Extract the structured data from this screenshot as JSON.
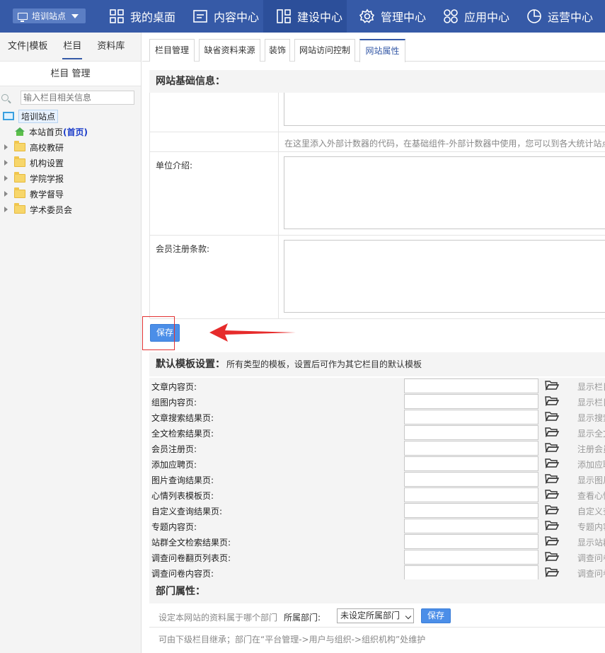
{
  "topnav": {
    "site_select": "培训站点",
    "items": [
      {
        "label": "我的桌面",
        "icon": "grid-icon"
      },
      {
        "label": "内容中心",
        "icon": "document-icon"
      },
      {
        "label": "建设中心",
        "icon": "layout-icon"
      },
      {
        "label": "管理中心",
        "icon": "gear-icon"
      },
      {
        "label": "应用中心",
        "icon": "apps-icon"
      },
      {
        "label": "运营中心",
        "icon": "pie-chart-icon"
      }
    ],
    "active": "建设中心"
  },
  "sidebar": {
    "tabs": [
      "文件|模板",
      "栏目",
      "资料库"
    ],
    "active_tab": "栏目",
    "header": "栏目 管理",
    "search_placeholder": "输入栏目相关信息",
    "root": "培训站点",
    "home_label": "本站首页",
    "home_suffix": "(首页)",
    "items": [
      "高校教研",
      "机构设置",
      "学院学报",
      "教学督导",
      "学术委员会"
    ]
  },
  "main": {
    "tabs": [
      "栏目管理",
      "缺省资料来源",
      "装饰",
      "网站访问控制",
      "网站属性"
    ],
    "active_tab": "网站属性",
    "basic_title": "网站基础信息：",
    "counter_hint": "在这里添入外部计数器的代码，在基础组件-外部计数器中使用，您可以到各大统计站点",
    "unit_intro_label": "单位介绍:",
    "member_terms_label": "会员注册条款:",
    "save_label": "保存",
    "template_title": "默认模板设置：",
    "template_desc": "所有类型的模板，设置后可作为其它栏目的默认模板",
    "templates": [
      {
        "label": "文章内容页:",
        "desc": "显示栏目"
      },
      {
        "label": "组图内容页:",
        "desc": "显示栏目"
      },
      {
        "label": "文章搜索结果页:",
        "desc": "显示搜索"
      },
      {
        "label": "全文检索结果页:",
        "desc": "显示全文"
      },
      {
        "label": "会员注册页:",
        "desc": "注册会员"
      },
      {
        "label": "添加应聘页:",
        "desc": "添加应聘"
      },
      {
        "label": "图片查询结果页:",
        "desc": "显示图片"
      },
      {
        "label": "心情列表模板页:",
        "desc": "查看心情"
      },
      {
        "label": "自定义查询结果页:",
        "desc": "自定义查"
      },
      {
        "label": "专题内容页:",
        "desc": "专题内容"
      },
      {
        "label": "站群全文检索结果页:",
        "desc": "显示站群"
      },
      {
        "label": "调查问卷翻页列表页:",
        "desc": "调查问卷"
      },
      {
        "label": "调查问卷内容页:",
        "desc": "调查问卷"
      }
    ],
    "dept_title": "部门属性：",
    "dept_hint": "设定本网站的资料属于哪个部门",
    "dept_label": "所属部门:",
    "dept_value": "未设定所属部门",
    "dept_save": "保存",
    "dept_footer": "可由下级栏目继承；部门在“平台管理->用户与组织->组织机构”处维护"
  }
}
